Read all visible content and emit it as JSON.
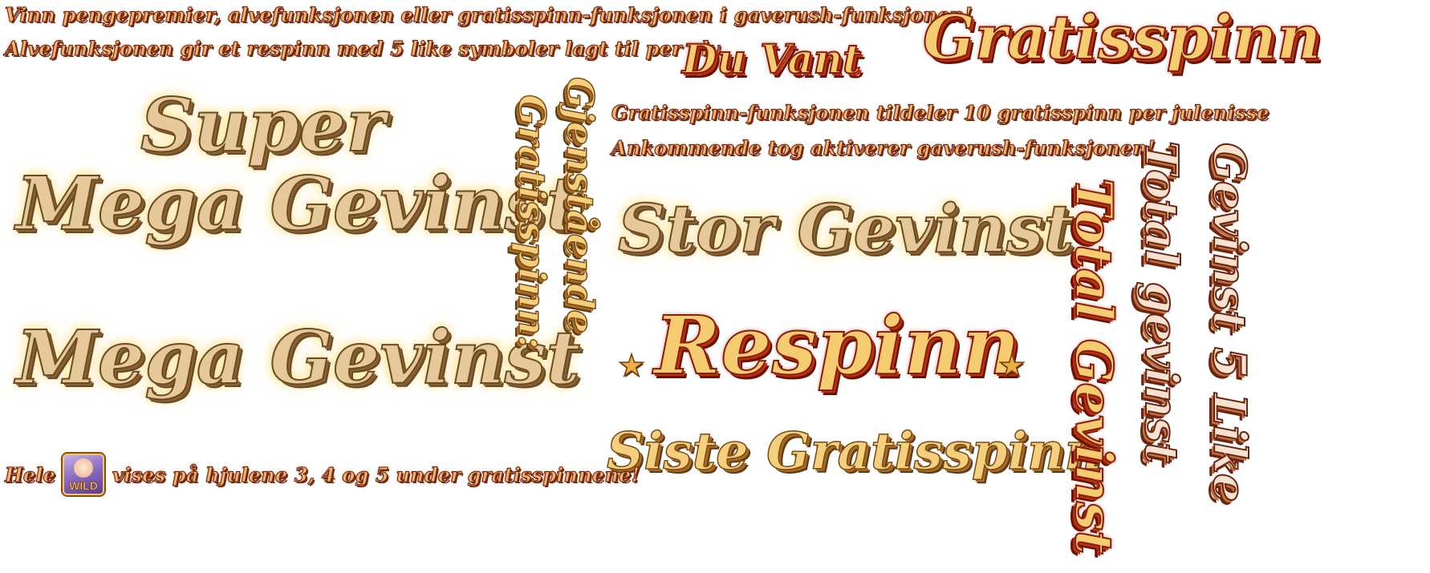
{
  "info_lines": {
    "line1": "Vinn pengepremier, alvefunksjonen eller gratisspinn-funksjonen i gaverush-funksjonen!",
    "line2": "Alvefunksjonen gir et respinn med 5 like symboler lagt til per alv.",
    "line3": "Gratisspinn-funksjonen tildeler 10 gratisspinn per julenisse",
    "line4": "Ankommende tog aktiverer gaverush-funksjonen!",
    "bottom_prefix": "Hele",
    "bottom_suffix": "vises på hjulene 3, 4 og 5 under gratisspinnene!",
    "wild_label": "WILD"
  },
  "titles": {
    "du_vant": "Du Vant",
    "gratisspinn": "Gratisspinn",
    "super": "Super",
    "super_mega_gevinst": "Mega Gevinst",
    "mega_gevinst": "Mega Gevinst",
    "gjenstaende": "Gjenstående",
    "gratisspinn_colon": "Gratisspinn:",
    "stor_gevinst": "Stor Gevinst",
    "respinn": "Respinn",
    "siste_gratisspinn": "Siste Gratisspinn",
    "total_gevinst_red": "Total Gevinst",
    "total_gevinst_rose": "Total gevinst",
    "gevinst_5_like": "Gevinst 5 Like"
  },
  "icons": {
    "star": "★"
  },
  "colors": {
    "cream": "#e6c99a",
    "gold": "#f6cc70",
    "outline_red": "#8a1a0a",
    "outline_brown": "#6b4a24"
  }
}
